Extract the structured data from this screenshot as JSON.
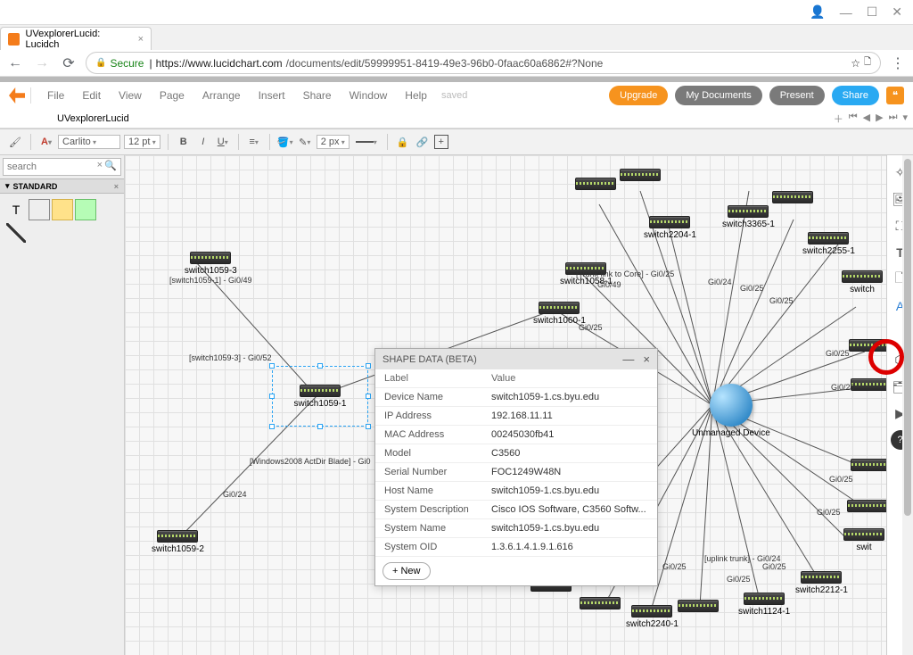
{
  "browser": {
    "tab_title": "UVexplorerLucid: Lucidch",
    "secure_label": "Secure",
    "url_host": "https://www.lucidchart.com",
    "url_path": "/documents/edit/59999951-8419-49e3-96b0-0faac60a6862#?None"
  },
  "menus": [
    "File",
    "Edit",
    "View",
    "Page",
    "Arrange",
    "Insert",
    "Share",
    "Window",
    "Help"
  ],
  "saved_label": "saved",
  "header_buttons": {
    "upgrade": "Upgrade",
    "my_docs": "My Documents",
    "present": "Present",
    "share": "Share"
  },
  "doc_tab": "UVexplorerLucid",
  "format_bar": {
    "font_family": "Carlito",
    "font_size": "12 pt",
    "line_width": "2 px"
  },
  "left_panel": {
    "search_placeholder": "search",
    "section": "STANDARD",
    "shape_text": "T"
  },
  "shape_data": {
    "title": "SHAPE DATA (BETA)",
    "head_label": "Label",
    "head_value": "Value",
    "rows": [
      {
        "label": "Device Name",
        "value": "switch1059-1.cs.byu.edu"
      },
      {
        "label": "IP Address",
        "value": "192.168.11.11"
      },
      {
        "label": "MAC Address",
        "value": "00245030fb41"
      },
      {
        "label": "Model",
        "value": "C3560"
      },
      {
        "label": "Serial Number",
        "value": "FOC1249W48N"
      },
      {
        "label": "Host Name",
        "value": "switch1059-1.cs.byu.edu"
      },
      {
        "label": "System Description",
        "value": "Cisco IOS Software, C3560 Softw..."
      },
      {
        "label": "System Name",
        "value": "switch1059-1.cs.byu.edu"
      },
      {
        "label": "System OID",
        "value": "1.3.6.1.4.1.9.1.616"
      }
    ],
    "new_button": "+  New"
  },
  "nodes": {
    "s1059_3": {
      "label": "switch1059-3",
      "sub": "[switch1059-1] - Gi0/49"
    },
    "s1059_1": {
      "label": "switch1059-1"
    },
    "s1059_2": {
      "label": "switch1059-2"
    },
    "s1058_1": {
      "label": "switch1058-1"
    },
    "s1060_1": {
      "label": "switch1060-1"
    },
    "s2204_1": {
      "label": "switch2204-1"
    },
    "s3365_1": {
      "label": "switch3365-1"
    },
    "s2255_1": {
      "label": "switch2255-1"
    },
    "switchR": {
      "label": "switch"
    },
    "s2240_1": {
      "label": "switch2240-1"
    },
    "s1124_1": {
      "label": "switch1124-1"
    },
    "s2212_1": {
      "label": "switch2212-1"
    },
    "switR": {
      "label": "swit"
    },
    "unmanaged": {
      "label": "Unmanaged Device"
    }
  },
  "edge_labels": {
    "e1": "[switch1059-3] - Gi0/52",
    "e2": "[Windows2008 ActDir Blade] - Gi0",
    "e3": "Gi0/24",
    "e4": "[Trunk link to Core] - Gi0/25",
    "e5": "Gi0/49",
    "e6": "Gi0/25",
    "e7": "Gi0/24",
    "e8": "Gi0/25",
    "e9": "Gi0/25",
    "e10": "Gi0/25",
    "e11": "Gi0/25",
    "e12": "Gi0/25",
    "e13": "Gi0/25",
    "e14": "Gi0/25",
    "e15": "Gi0/25",
    "e16": "[uplink trunk] - Gi0/24",
    "e17": "Gi0/25"
  }
}
